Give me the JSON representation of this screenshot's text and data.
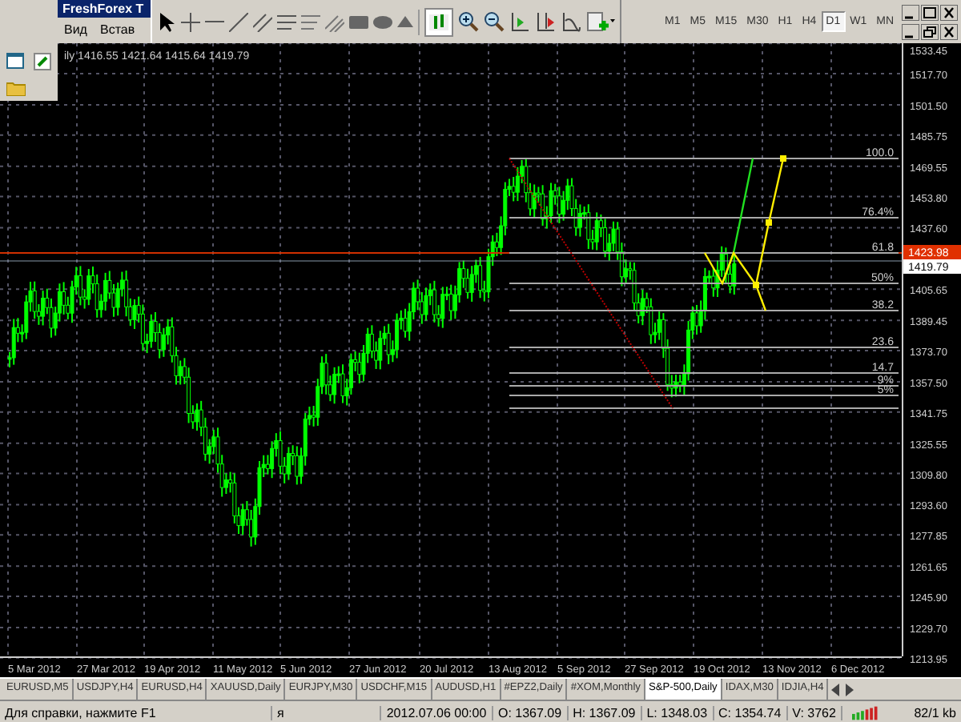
{
  "window": {
    "title": "FreshForex T"
  },
  "menu": [
    "Вид",
    "Встав"
  ],
  "timeframes": [
    {
      "label": "M1",
      "selected": false
    },
    {
      "label": "M5",
      "selected": false
    },
    {
      "label": "M15",
      "selected": false
    },
    {
      "label": "M30",
      "selected": false
    },
    {
      "label": "H1",
      "selected": false
    },
    {
      "label": "H4",
      "selected": false
    },
    {
      "label": "D1",
      "selected": true
    },
    {
      "label": "W1",
      "selected": false
    },
    {
      "label": "MN",
      "selected": false
    }
  ],
  "chart": {
    "info": "ily 1416.55 1421.64 1415.64 1419.79",
    "price_labels": [
      "1533.45",
      "1517.70",
      "1501.50",
      "1485.75",
      "1469.55",
      "1453.80",
      "1437.60",
      "1405.65",
      "1389.45",
      "1373.70",
      "1357.50",
      "1341.75",
      "1325.55",
      "1309.80",
      "1293.60",
      "1277.85",
      "1261.65",
      "1245.90",
      "1229.70",
      "1213.95"
    ],
    "bid_label": "1423.98",
    "last_label": "1419.79",
    "fib_labels": [
      "100.0",
      "76.4%",
      "61.8",
      "50%",
      "38.2",
      "23.6",
      "14.7",
      "9%",
      "5%"
    ],
    "date_labels": [
      "5 Mar 2012",
      "27 Mar 2012",
      "19 Apr 2012",
      "11 May 2012",
      "5 Jun 2012",
      "27 Jun 2012",
      "20 Jul 2012",
      "13 Aug 2012",
      "5 Sep 2012",
      "27 Sep 2012",
      "19 Oct 2012",
      "13 Nov 2012",
      "6 Dec 2012"
    ]
  },
  "tabs": [
    {
      "label": "EURUSD,M5",
      "selected": false
    },
    {
      "label": "USDJPY,H4",
      "selected": false
    },
    {
      "label": "EURUSD,H4",
      "selected": false
    },
    {
      "label": "XAUUSD,Daily",
      "selected": false
    },
    {
      "label": "EURJPY,M30",
      "selected": false
    },
    {
      "label": "USDCHF,M15",
      "selected": false
    },
    {
      "label": "AUDUSD,H1",
      "selected": false
    },
    {
      "label": "#EPZ2,Daily",
      "selected": false
    },
    {
      "label": "#XOM,Monthly",
      "selected": false
    },
    {
      "label": "S&P-500,Daily",
      "selected": true
    },
    {
      "label": "IDAX,M30",
      "selected": false
    },
    {
      "label": "IDJIA,H4",
      "selected": false
    }
  ],
  "status_bar": {
    "help": "Для справки, нажмите F1",
    "profile": "я",
    "time": "2012.07.06 00:00",
    "open": "O: 1367.09",
    "high": "H: 1367.09",
    "low": "L: 1348.03",
    "close": "C: 1354.74",
    "volume": "V: 3762",
    "traffic": "82/1 kb"
  }
}
